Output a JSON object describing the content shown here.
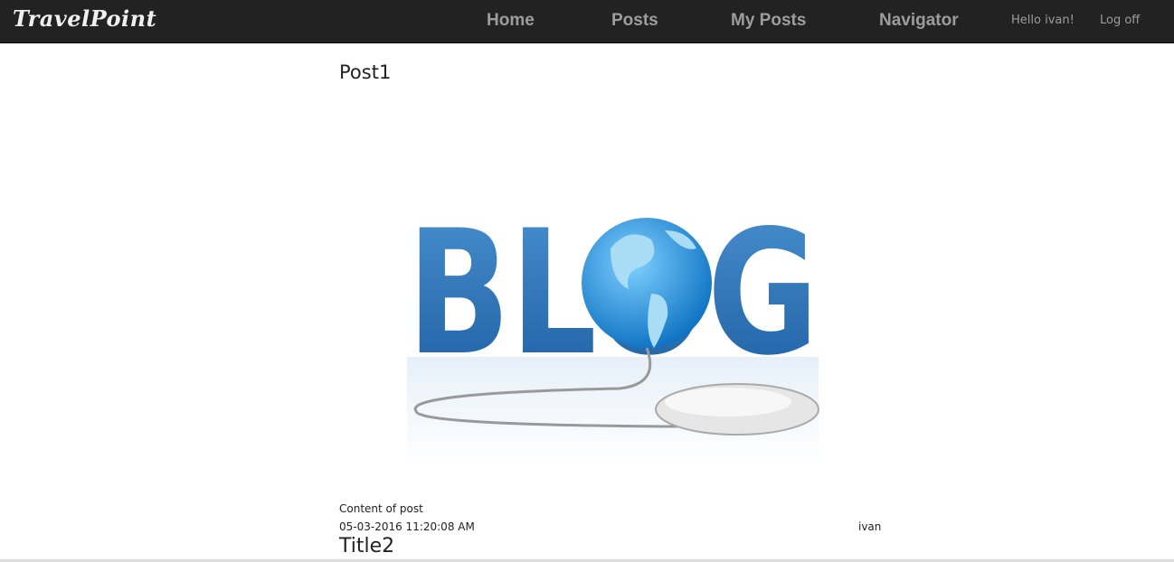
{
  "navbar": {
    "brand": "TravelPoint",
    "links": [
      "Home",
      "Posts",
      "My Posts",
      "Navigator"
    ],
    "greeting": "Hello ivan!",
    "logoff": "Log off"
  },
  "posts": [
    {
      "title": "Post1",
      "image_text": "BLOG",
      "content": "Content of post",
      "date": "05-03-2016 11:20:08 AM",
      "author": "ivan"
    },
    {
      "title": "Title2"
    }
  ]
}
